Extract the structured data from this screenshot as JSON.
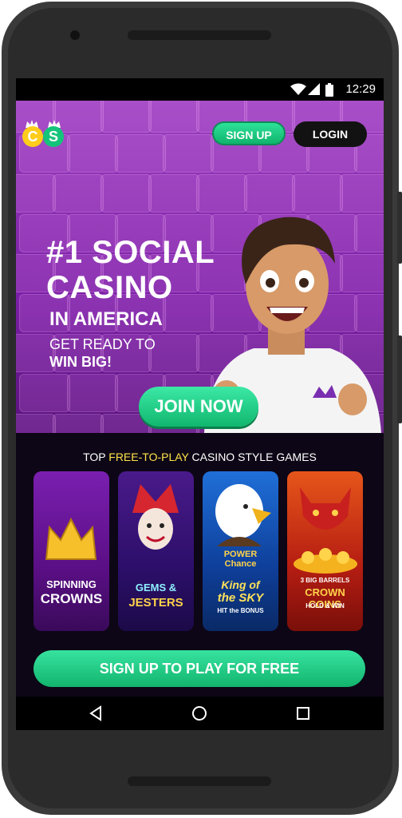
{
  "status_bar": {
    "time": "12:29"
  },
  "header": {
    "logo_letters": [
      "C",
      "S"
    ],
    "signup_label": "SIGN UP",
    "login_label": "LOGIN"
  },
  "hero": {
    "headline_line1": "#1 SOCIAL",
    "headline_line2": "CASINO",
    "headline_line3": "IN AMERICA",
    "sub_line1": "GET READY TO",
    "sub_line2": "WIN BIG!",
    "join_label": "JOIN NOW"
  },
  "games": {
    "title_prefix": "TOP ",
    "title_highlight": "FREE-TO-PLAY",
    "title_suffix": " CASINO STYLE GAMES",
    "cards": [
      {
        "line1": "SPINNING",
        "line2": "CROWNS"
      },
      {
        "line1": "GEMS &",
        "line2": "JESTERS"
      },
      {
        "line1": "King of",
        "line2": "the SKY"
      },
      {
        "line1": "3 BIG BARRELS",
        "line2": "CROWN COINS"
      }
    ],
    "card3_badge_line1": "POWER",
    "card3_badge_line2": "Chance",
    "card3_tagline": "HIT the BONUS",
    "card4_tagline": "HOLD & WIN"
  },
  "cta_label": "SIGN UP TO PLAY FOR FREE",
  "colors": {
    "accent_green": "#15c47a",
    "hero_purple": "#8c2fb3",
    "highlight_yellow": "#ffe34a"
  }
}
